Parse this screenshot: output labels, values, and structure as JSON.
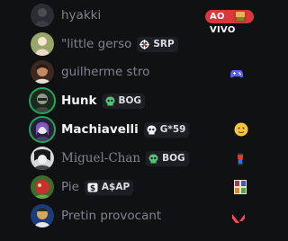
{
  "members": [
    {
      "name": "hyakki",
      "style": "muted",
      "tag": null,
      "live_badge": "AO VIVO",
      "activity_icon": "game-thumbnail-icon"
    },
    {
      "name": "\"little gerso",
      "style": "muted",
      "tag": {
        "icon": "crosshair-badge-icon",
        "text": "SRP"
      },
      "live_badge": null,
      "activity_icon": null
    },
    {
      "name": "guilherme stro",
      "style": "muted",
      "tag": null,
      "live_badge": null,
      "activity_icon": "gamepad-icon"
    },
    {
      "name": "Hunk",
      "style": "bold",
      "tag": {
        "icon": "skull-badge-icon",
        "text": "BOG"
      },
      "live_badge": null,
      "activity_icon": null
    },
    {
      "name": "Machiavelli",
      "style": "bold",
      "tag": {
        "icon": "skull-badge-icon",
        "text": "G*59"
      },
      "live_badge": null,
      "activity_icon": "emoji-icon"
    },
    {
      "name": "Miguel-Chan",
      "style": "serif",
      "tag": {
        "icon": "skull-badge-icon",
        "text": "BOG"
      },
      "live_badge": null,
      "activity_icon": "game-thumbnail-icon"
    },
    {
      "name": "Pie",
      "style": "muted",
      "tag": {
        "icon": "dollar-badge-icon",
        "text": "A$AP"
      },
      "live_badge": null,
      "activity_icon": "game-thumbnail-icon"
    },
    {
      "name": "Pretin provocant",
      "style": "muted",
      "tag": null,
      "live_badge": null,
      "activity_icon": "valorant-icon"
    }
  ],
  "colors": {
    "background": "#101113",
    "live": "#da373c",
    "online": "#23a55a",
    "tag_bg": "#1e1f22"
  }
}
